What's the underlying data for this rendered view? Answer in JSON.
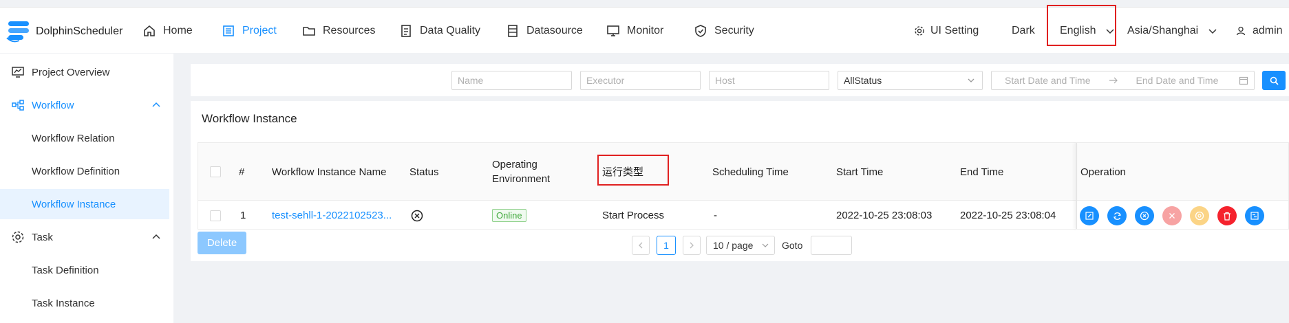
{
  "app": {
    "name": "DolphinScheduler"
  },
  "nav": {
    "items": [
      {
        "label": "Home",
        "icon": "home-icon"
      },
      {
        "label": "Project",
        "icon": "project-icon",
        "active": true
      },
      {
        "label": "Resources",
        "icon": "folder-icon"
      },
      {
        "label": "Data Quality",
        "icon": "data-quality-icon"
      },
      {
        "label": "Datasource",
        "icon": "database-icon"
      },
      {
        "label": "Monitor",
        "icon": "monitor-icon"
      },
      {
        "label": "Security",
        "icon": "shield-icon"
      }
    ],
    "ui_setting": "UI Setting",
    "theme": "Dark",
    "language": "English",
    "timezone": "Asia/Shanghai",
    "user": "admin"
  },
  "sidebar": {
    "project_overview": "Project Overview",
    "workflow": "Workflow",
    "workflow_relation": "Workflow Relation",
    "workflow_definition": "Workflow Definition",
    "workflow_instance": "Workflow Instance",
    "task": "Task",
    "task_definition": "Task Definition",
    "task_instance": "Task Instance"
  },
  "filters": {
    "name_placeholder": "Name",
    "executor_placeholder": "Executor",
    "host_placeholder": "Host",
    "status_value": "AllStatus",
    "start_date_placeholder": "Start Date and Time",
    "end_date_placeholder": "End Date and Time"
  },
  "card": {
    "title": "Workflow Instance"
  },
  "table": {
    "headers": {
      "index": "#",
      "name": "Workflow Instance Name",
      "status": "Status",
      "env_line1": "Operating",
      "env_line2": "Environment",
      "run_type": "运行类型",
      "scheduling_time": "Scheduling Time",
      "start_time": "Start Time",
      "end_time": "End Time",
      "operation": "Operation"
    },
    "rows": [
      {
        "index": "1",
        "name": "test-sehll-1-2022102523...",
        "env": "Online",
        "run_type": "Start Process",
        "scheduling_time": "-",
        "start_time": "2022-10-25 23:08:03",
        "end_time": "2022-10-25 23:08:04"
      }
    ]
  },
  "footer": {
    "delete": "Delete",
    "page": "1",
    "page_size": "10 / page",
    "goto": "Goto"
  },
  "colors": {
    "accent": "#1890ff",
    "highlight_box": "#e02020",
    "op_blue": "#1890ff",
    "op_red_light": "#f7a3a3",
    "op_orange_light": "#fbd486",
    "op_red": "#f5222d"
  }
}
